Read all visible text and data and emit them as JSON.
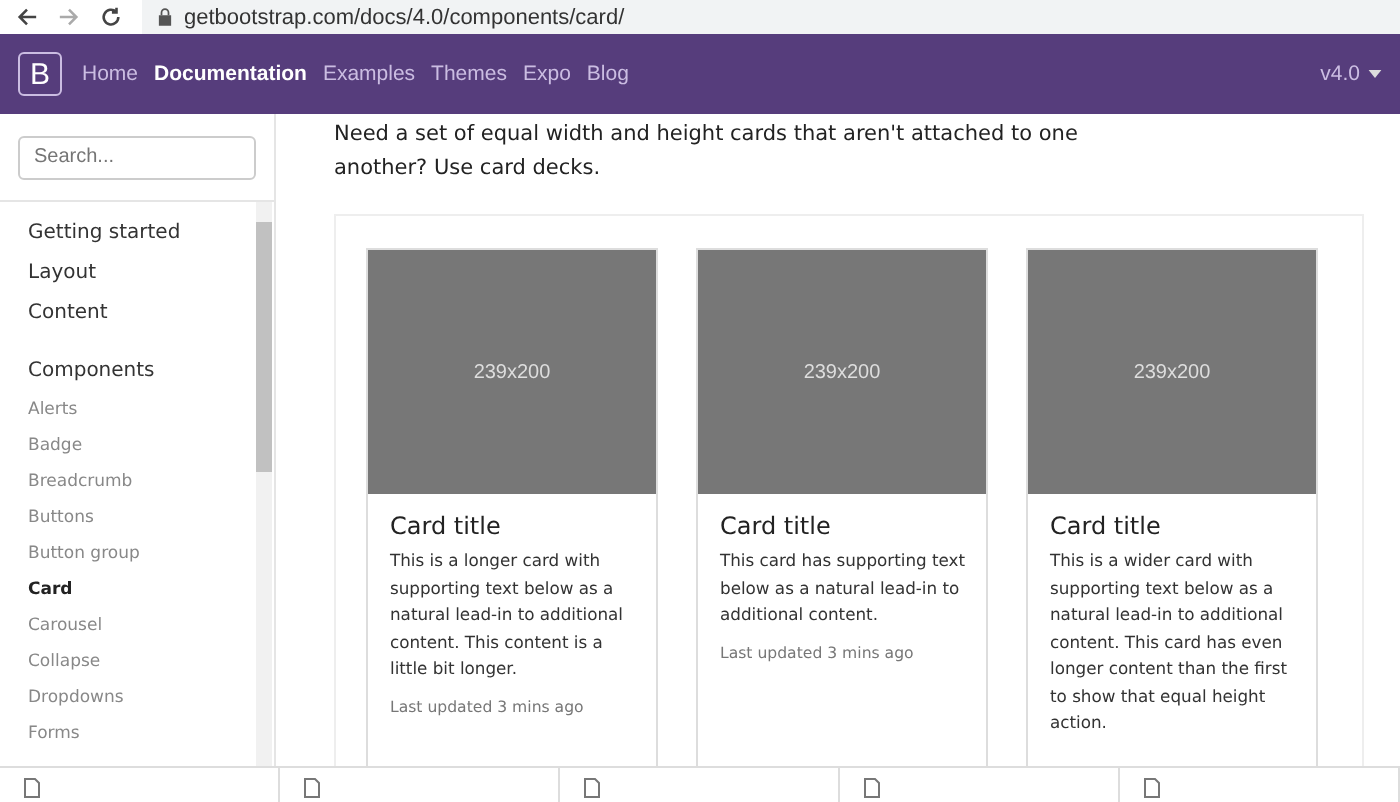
{
  "browser": {
    "url": "getbootstrap.com/docs/4.0/components/card/"
  },
  "navbar": {
    "brand": "B",
    "links": [
      {
        "label": "Home",
        "selected": false
      },
      {
        "label": "Documentation",
        "selected": true
      },
      {
        "label": "Examples",
        "selected": false
      },
      {
        "label": "Themes",
        "selected": false
      },
      {
        "label": "Expo",
        "selected": false
      },
      {
        "label": "Blog",
        "selected": false
      }
    ],
    "version": "v4.0"
  },
  "sidebar": {
    "search": {
      "placeholder": "Search..."
    },
    "items": [
      {
        "label": "Getting started",
        "kind": "section",
        "selected": false
      },
      {
        "label": "Layout",
        "kind": "section",
        "selected": false
      },
      {
        "label": "Content",
        "kind": "section",
        "selected": false
      },
      {
        "label": "Components",
        "kind": "section",
        "selected": false,
        "children": [
          {
            "label": "Alerts",
            "selected": false
          },
          {
            "label": "Badge",
            "selected": false
          },
          {
            "label": "Breadcrumb",
            "selected": false
          },
          {
            "label": "Buttons",
            "selected": false
          },
          {
            "label": "Button group",
            "selected": false
          },
          {
            "label": "Card",
            "selected": true
          },
          {
            "label": "Carousel",
            "selected": false
          },
          {
            "label": "Collapse",
            "selected": false
          },
          {
            "label": "Dropdowns",
            "selected": false
          },
          {
            "label": "Forms",
            "selected": false
          }
        ]
      }
    ]
  },
  "content": {
    "intro": "Need a set of equal width and height cards that aren't attached to one another? Use card decks.",
    "cards": [
      {
        "image_label": "239x200",
        "title": "Card title",
        "text": "This is a longer card with supporting text below as a natural lead-in to additional content. This content is a little bit longer.",
        "footer": "Last updated 3 mins ago"
      },
      {
        "image_label": "239x200",
        "title": "Card title",
        "text": "This card has supporting text below as a natural lead-in to additional content.",
        "footer": "Last updated 3 mins ago"
      },
      {
        "image_label": "239x200",
        "title": "Card title",
        "text": "This is a wider card with supporting text below as a natural lead-in to additional content. This card has even longer content than the first to show that equal height action."
      }
    ]
  },
  "downloads": {
    "items": [
      {
        "kind": "file"
      },
      {
        "kind": "file"
      },
      {
        "kind": "file"
      },
      {
        "kind": "file"
      },
      {
        "kind": "file"
      }
    ]
  }
}
